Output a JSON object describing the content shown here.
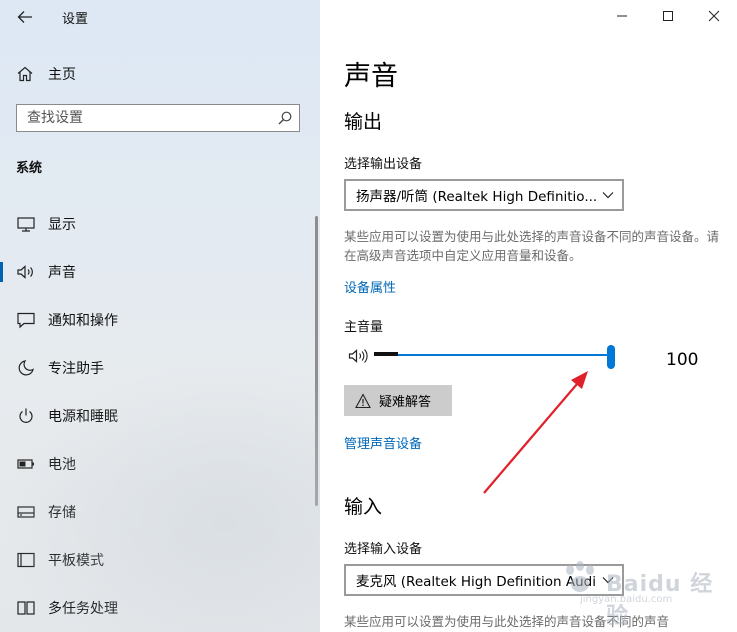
{
  "window": {
    "title": "设置"
  },
  "sidebar": {
    "home_label": "主页",
    "search_placeholder": "查找设置",
    "section_label": "系统",
    "items": [
      {
        "label": "显示",
        "icon": "monitor-icon"
      },
      {
        "label": "声音",
        "icon": "speaker-icon",
        "active": true
      },
      {
        "label": "通知和操作",
        "icon": "notification-icon"
      },
      {
        "label": "专注助手",
        "icon": "moon-icon"
      },
      {
        "label": "电源和睡眠",
        "icon": "power-icon"
      },
      {
        "label": "电池",
        "icon": "battery-icon"
      },
      {
        "label": "存储",
        "icon": "storage-icon"
      },
      {
        "label": "平板模式",
        "icon": "tablet-icon"
      },
      {
        "label": "多任务处理",
        "icon": "multitask-icon"
      }
    ]
  },
  "main": {
    "title": "声音",
    "output": {
      "heading": "输出",
      "device_label": "选择输出设备",
      "device_value": "扬声器/听筒 (Realtek High Definitio...",
      "description": "某些应用可以设置为使用与此处选择的声音设备不同的声音设备。请在高级声音选项中自定义应用音量和设备。",
      "properties_link": "设备属性",
      "volume_label": "主音量",
      "volume_value": "100",
      "troubleshoot_label": "疑难解答",
      "manage_link": "管理声音设备"
    },
    "input": {
      "heading": "输入",
      "device_label": "选择输入设备",
      "device_value": "麦克风 (Realtek High Definition Audio)",
      "description": "某些应用可以设置为使用与此处选择的声音设备不同的声音"
    }
  },
  "watermark": {
    "text": "Baidu 经验",
    "sub": "jingyan.baidu.com"
  },
  "colors": {
    "accent": "#0078d7",
    "link": "#0067b8",
    "annotation": "#e0202a"
  }
}
